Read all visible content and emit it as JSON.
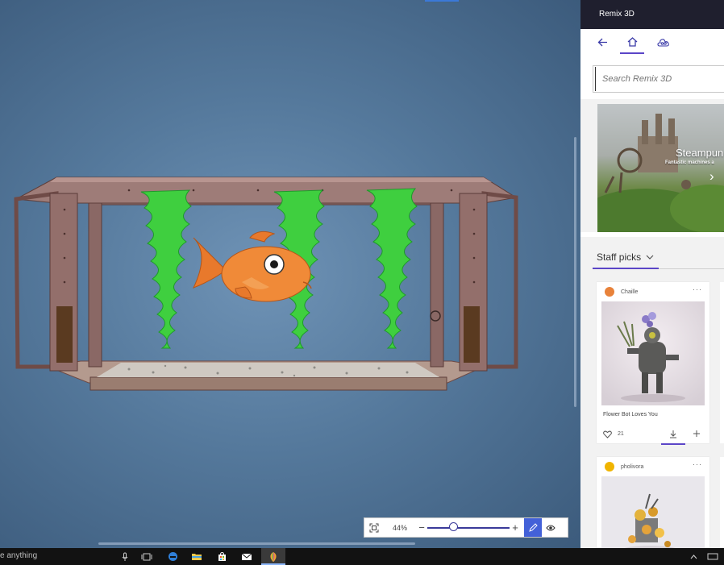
{
  "app": {
    "title": "Remix 3D"
  },
  "canvas": {
    "zoom_label": "44%",
    "zoom_level_fraction": 0.32
  },
  "panel": {
    "nav": {
      "back": "back-arrow",
      "home": "home",
      "cloud": "cloud-library",
      "active": "home"
    },
    "search": {
      "placeholder": "Search Remix 3D"
    },
    "hero": {
      "title": "Steampun",
      "subtitle": "Fantastic machines a"
    },
    "section": {
      "label": "Staff picks"
    },
    "cards": [
      {
        "author": "Chaille",
        "title": "Flower Bot Loves You",
        "likes": "21",
        "avatar_color": "#e8823a"
      },
      {
        "author": "pholivora",
        "title": "",
        "likes": "",
        "avatar_color": "#f0b400"
      }
    ]
  },
  "taskbar": {
    "search_text": "e anything"
  },
  "colors": {
    "accent": "#5b45c7",
    "panel_title_bg": "#1f1f2e",
    "edit_button": "#4361d8"
  }
}
